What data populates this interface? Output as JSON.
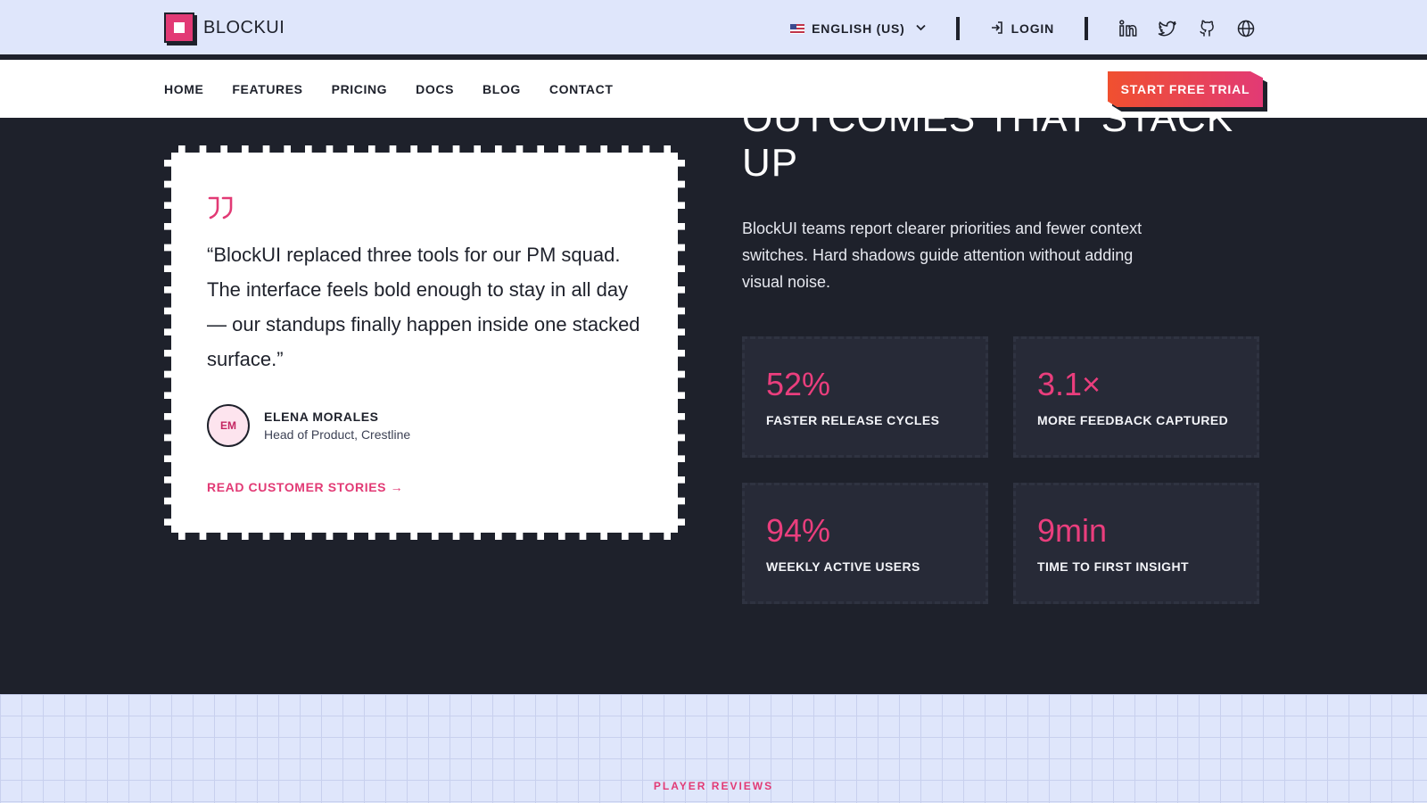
{
  "brand": {
    "name": "BLOCKUI"
  },
  "topbar": {
    "language_label": "ENGLISH (US)",
    "login_label": "LOGIN",
    "social_icons": [
      "linkedin-icon",
      "twitter-icon",
      "github-icon",
      "globe-icon"
    ]
  },
  "nav": {
    "items": [
      {
        "label": "HOME"
      },
      {
        "label": "FEATURES"
      },
      {
        "label": "PRICING"
      },
      {
        "label": "DOCS"
      },
      {
        "label": "BLOG"
      },
      {
        "label": "CONTACT"
      }
    ],
    "cta_label": "START FREE TRIAL"
  },
  "outcomes": {
    "heading": "OUTCOMES THAT STACK UP",
    "lede": "BlockUI teams report clearer priorities and fewer context switches. Hard shadows guide attention without adding visual noise.",
    "stats": [
      {
        "value": "52%",
        "label": "FASTER RELEASE CYCLES"
      },
      {
        "value": "3.1×",
        "label": "MORE FEEDBACK CAPTURED"
      },
      {
        "value": "94%",
        "label": "WEEKLY ACTIVE USERS"
      },
      {
        "value": "9min",
        "label": "TIME TO FIRST INSIGHT"
      }
    ]
  },
  "testimonial": {
    "quote": "“BlockUI replaced three tools for our PM squad. The interface feels bold enough to stay in all day — our standups finally happen inside one stacked surface.”",
    "avatar_initials": "EM",
    "author_name": "ELENA MORALES",
    "author_role": "Head of Product, Crestline",
    "link_label": "READ CUSTOMER STORIES →"
  },
  "reviews": {
    "eyebrow": "PLAYER REVIEWS"
  },
  "colors": {
    "accent": "#e23a75",
    "accent_orange": "#f0502f",
    "dark_bg": "#1e212b",
    "light_bg": "#dfe6fb",
    "stat_card_bg": "#272a37"
  }
}
